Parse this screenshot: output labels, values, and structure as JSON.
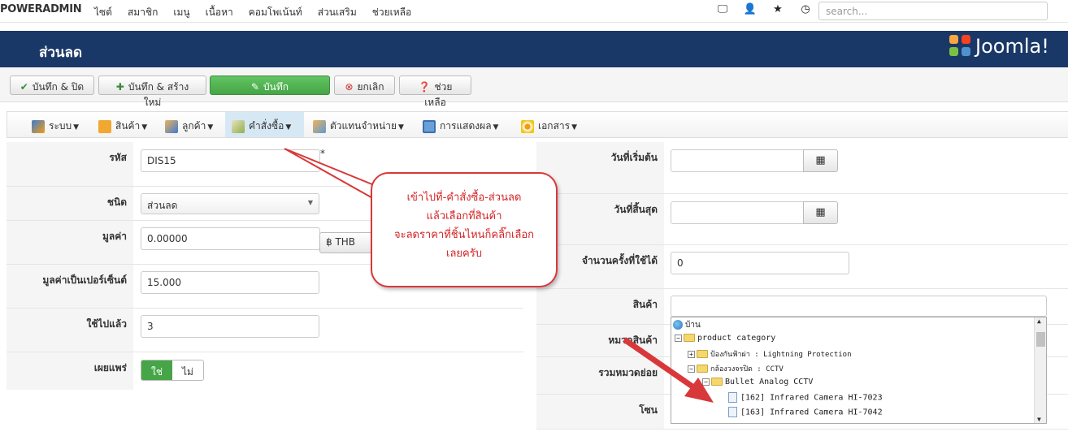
{
  "topbar": {
    "brand": "POWERADMIN",
    "menu": [
      "ไซต์",
      "สมาชิก",
      "เมนู",
      "เนื้อหา",
      "คอมโพเน้นท์",
      "ส่วนเสริม",
      "ช่วยเหลือ"
    ],
    "search_placeholder": "search..."
  },
  "header": {
    "title": "ส่วนลด",
    "logo_text": "Joomla!"
  },
  "toolbar": {
    "save_close": "บันทึก & ปิด",
    "save_new": "บันทึก & สร้างใหม่",
    "save": "บันทึก",
    "cancel": "ยกเลิก",
    "help": "ช่วยเหลือ"
  },
  "menubar": [
    "ระบบ",
    "สินค้า",
    "ลูกค้า",
    "คำสั่งซื้อ",
    "ตัวแทนจำหน่าย",
    "การแสดงผล",
    "เอกสาร"
  ],
  "form_left": {
    "code_label": "รหัส",
    "code_value": "DIS15",
    "required_mark": "*",
    "type_label": "ชนิด",
    "type_value": "ส่วนลด",
    "value_label": "มูลค่า",
    "value_value": "0.00000",
    "currency": "฿ THB",
    "percent_label": "มูลค่าเป็นเปอร์เซ็นต์",
    "percent_value": "15.000",
    "used_label": "ใช้ไปแล้ว",
    "used_value": "3",
    "publish_label": "เผยแพร่",
    "publish_yes": "ใช่",
    "publish_no": "ไม่"
  },
  "form_right": {
    "start_label": "วันที่เริ่มต้น",
    "end_label": "วันที่สิ้นสุด",
    "uses_label": "จำนวนครั้งที่ใช้ได้",
    "uses_value": "0",
    "product_label": "สินค้า",
    "category_label": "หมวดสินค้า",
    "subcat_label": "รวมหมวดย่อย",
    "zone_label": "โซน"
  },
  "tree": [
    "บ้าน",
    "product category",
    "ป้องกันฟ้าผ่า : Lightning Protection",
    "กล้องวงจรปิด : CCTV",
    "Bullet Analog CCTV",
    "[162] Infrared Camera HI-7023",
    "[163] Infrared Camera HI-7042"
  ],
  "callout": [
    "เข้าไปที่-คำสั่งซื้อ-ส่วนลด",
    "แล้วเลือกที่สินค้า",
    "จะลดราคาที่ชิ้นไหนก็คลิ๊กเลือก",
    "เลยครับ"
  ],
  "colors": {
    "header_bg": "#1a3867",
    "save_green": "#46a546",
    "annotation_red": "#d9383a"
  }
}
